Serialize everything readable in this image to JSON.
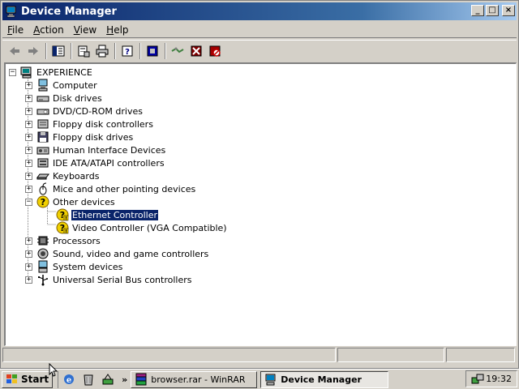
{
  "window": {
    "title": "Device Manager",
    "buttons": {
      "minimize": "_",
      "maximize": "□",
      "close": "×"
    }
  },
  "menubar": [
    {
      "key": "F",
      "rest": "ile"
    },
    {
      "key": "A",
      "rest": "ction"
    },
    {
      "key": "V",
      "rest": "iew"
    },
    {
      "key": "H",
      "rest": "elp"
    }
  ],
  "toolbar_icons": [
    "back-icon",
    "forward-icon",
    "show-hide-tree-icon",
    "properties-icon",
    "print-icon",
    "help-icon",
    "update-driver-icon",
    "scan-hardware-icon",
    "uninstall-icon",
    "disable-icon"
  ],
  "tree": {
    "root": "EXPERIENCE",
    "items": [
      {
        "label": "Computer",
        "icon": "computer-icon",
        "expander": "+"
      },
      {
        "label": "Disk drives",
        "icon": "disk-drive-icon",
        "expander": "+"
      },
      {
        "label": "DVD/CD-ROM drives",
        "icon": "cdrom-icon",
        "expander": "+"
      },
      {
        "label": "Floppy disk controllers",
        "icon": "controller-icon",
        "expander": "+"
      },
      {
        "label": "Floppy disk drives",
        "icon": "floppy-icon",
        "expander": "+"
      },
      {
        "label": "Human Interface Devices",
        "icon": "hid-icon",
        "expander": "+"
      },
      {
        "label": "IDE ATA/ATAPI controllers",
        "icon": "ide-icon",
        "expander": "+"
      },
      {
        "label": "Keyboards",
        "icon": "keyboard-icon",
        "expander": "+"
      },
      {
        "label": "Mice and other pointing devices",
        "icon": "mouse-icon",
        "expander": "+"
      },
      {
        "label": "Other devices",
        "icon": "unknown-device-icon",
        "expander": "−"
      },
      {
        "label": "Processors",
        "icon": "processor-icon",
        "expander": "+"
      },
      {
        "label": "Sound, video and game controllers",
        "icon": "sound-icon",
        "expander": "+"
      },
      {
        "label": "System devices",
        "icon": "system-icon",
        "expander": "+"
      },
      {
        "label": "Universal Serial Bus controllers",
        "icon": "usb-icon",
        "expander": "+"
      }
    ],
    "other_devices_children": [
      {
        "label": "Ethernet Controller",
        "selected": true
      },
      {
        "label": "Video Controller (VGA Compatible)",
        "selected": false
      }
    ]
  },
  "taskbar": {
    "start": "Start",
    "quick_launch_more": "»",
    "tasks": [
      {
        "label": "browser.rar - WinRAR",
        "active": false
      },
      {
        "label": "Device Manager",
        "active": true
      }
    ],
    "clock": "19:32"
  },
  "colors": {
    "titlebar_start": "#0a246a",
    "titlebar_end": "#a6caf0",
    "window_face": "#d4d0c8",
    "selection": "#0a246a"
  }
}
